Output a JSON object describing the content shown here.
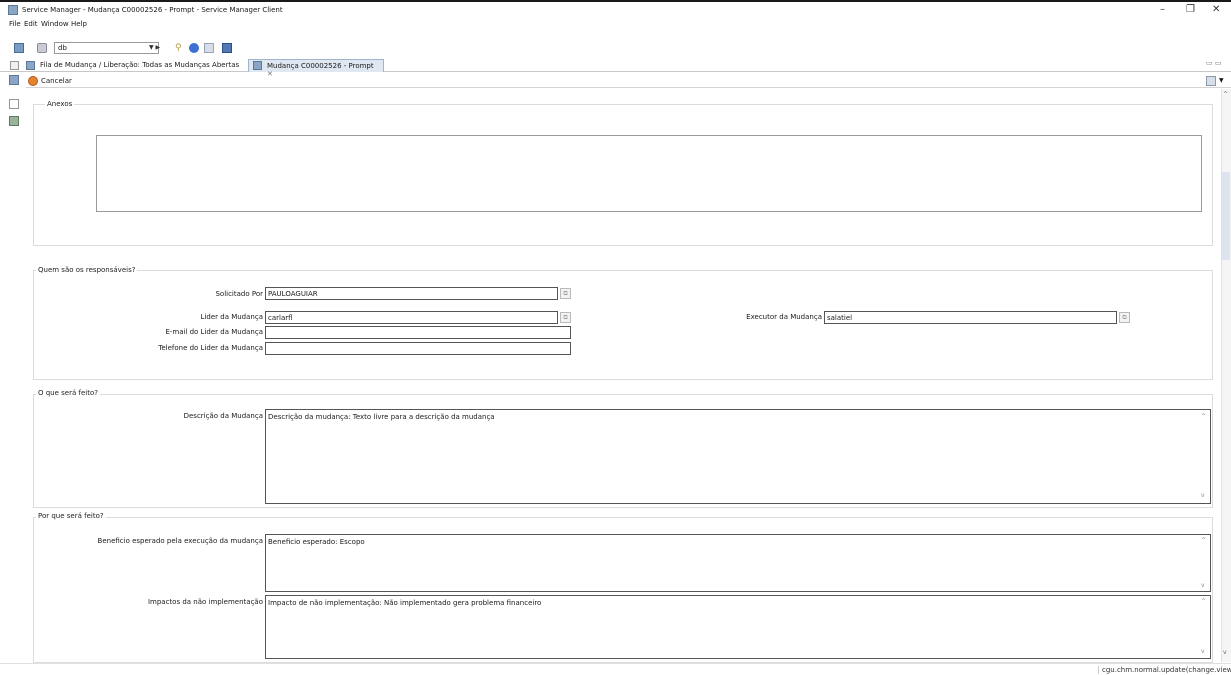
{
  "window": {
    "title": "Service Manager - Mudança C00002526 - Prompt - Service Manager Client",
    "minimize": "–",
    "restore": "❐",
    "close": "✕"
  },
  "menu": [
    "File",
    "Edit",
    "Window",
    "Help"
  ],
  "toolbar": {
    "combo_value": "db"
  },
  "tabs": [
    {
      "label": "Fila de Mudança / Liberação: Todas as Mudanças Abertas",
      "active": false
    },
    {
      "label": "Mudança C00002526 - Prompt",
      "active": true,
      "close": "✕"
    }
  ],
  "actions": {
    "cancel_label": "Cancelar"
  },
  "sections": {
    "anexos": {
      "title": "Anexos"
    },
    "responsaveis": {
      "title": "Quem são os responsáveis?",
      "solicitado_por_label": "Solicitado Por",
      "solicitado_por_value": "PAULOAGUIAR",
      "lider_label": "Lider da Mudança",
      "lider_value": "carlarfl",
      "executor_label": "Executor da Mudança",
      "executor_value": "salatiel",
      "email_label": "E-mail do Lider da Mudança",
      "email_value": "",
      "telefone_label": "Telefone do Lider da Mudança",
      "telefone_value": ""
    },
    "oque": {
      "title": "O que será feito?",
      "descricao_label": "Descrição da Mudança",
      "descricao_value": "Descrição da mudança: Texto livre para a descrição da mudança"
    },
    "porque": {
      "title": "Por que será feito?",
      "beneficio_label": "Beneficio esperado pela execução da mudança",
      "beneficio_value": "Beneficio esperado: Escopo",
      "impactos_label": "Impactos da não implementação",
      "impactos_value": "Impacto de não implementação: Não implementado gera problema financeiro"
    }
  },
  "status": {
    "text": "cgu.chm.normal.update(change.view"
  },
  "icons": {
    "app": "service-manager-icon",
    "cancel": "cancel-icon",
    "lookup": "lookup-icon"
  }
}
